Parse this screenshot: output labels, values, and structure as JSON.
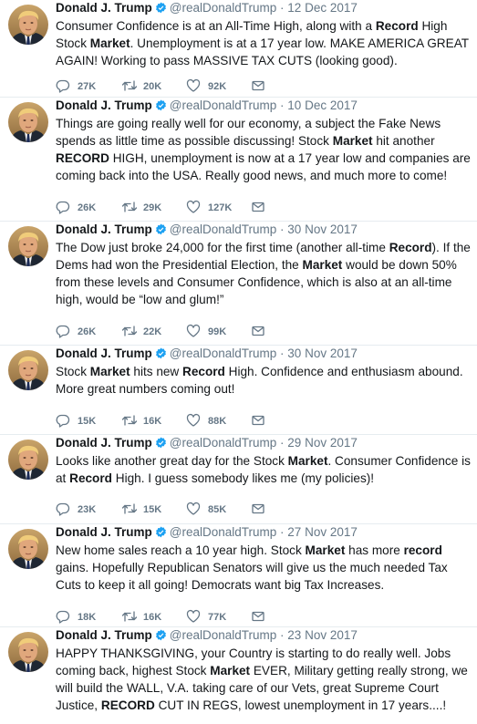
{
  "colors": {
    "text": "#14171a",
    "secondary": "#657786",
    "verified": "#1da1f2",
    "divider": "#e6ecf0"
  },
  "tweets": [
    {
      "name": "Donald J. Trump",
      "handle": "@realDonaldTrump",
      "separator": "·",
      "date": "12 Dec 2017",
      "text_segments": [
        {
          "t": "Consumer Confidence is at an All-Time High, along with a ",
          "b": false
        },
        {
          "t": "Record",
          "b": true
        },
        {
          "t": " High Stock ",
          "b": false
        },
        {
          "t": "Market",
          "b": true
        },
        {
          "t": ". Unemployment is at a 17 year low. MAKE AMERICA GREAT AGAIN! Working to pass MASSIVE TAX CUTS (looking good).",
          "b": false
        }
      ],
      "replies": "27K",
      "retweets": "20K",
      "likes": "92K"
    },
    {
      "name": "Donald J. Trump",
      "handle": "@realDonaldTrump",
      "separator": "·",
      "date": "10 Dec 2017",
      "text_segments": [
        {
          "t": "Things are going really well for our economy, a subject the Fake News spends as little time as possible discussing! Stock ",
          "b": false
        },
        {
          "t": "Market",
          "b": true
        },
        {
          "t": " hit another ",
          "b": false
        },
        {
          "t": "RECORD",
          "b": true
        },
        {
          "t": " HIGH, unemployment is now at a 17 year low and companies are coming back into the USA. Really good news, and much more to come!",
          "b": false
        }
      ],
      "replies": "26K",
      "retweets": "29K",
      "likes": "127K"
    },
    {
      "name": "Donald J. Trump",
      "handle": "@realDonaldTrump",
      "separator": "·",
      "date": "30 Nov 2017",
      "text_segments": [
        {
          "t": "The Dow just broke 24,000 for the first time (another all-time ",
          "b": false
        },
        {
          "t": "Record",
          "b": true
        },
        {
          "t": "). If the Dems had won the Presidential Election, the ",
          "b": false
        },
        {
          "t": "Market",
          "b": true
        },
        {
          "t": " would be down 50% from these levels and Consumer Confidence, which is also at an all-time high, would be “low and glum!”",
          "b": false
        }
      ],
      "replies": "26K",
      "retweets": "22K",
      "likes": "99K"
    },
    {
      "name": "Donald J. Trump",
      "handle": "@realDonaldTrump",
      "separator": "·",
      "date": "30 Nov 2017",
      "text_segments": [
        {
          "t": "Stock ",
          "b": false
        },
        {
          "t": "Market",
          "b": true
        },
        {
          "t": " hits new ",
          "b": false
        },
        {
          "t": "Record",
          "b": true
        },
        {
          "t": " High. Confidence and enthusiasm abound. More great numbers coming out!",
          "b": false
        }
      ],
      "replies": "15K",
      "retweets": "16K",
      "likes": "88K"
    },
    {
      "name": "Donald J. Trump",
      "handle": "@realDonaldTrump",
      "separator": "·",
      "date": "29 Nov 2017",
      "text_segments": [
        {
          "t": "Looks like another great day for the Stock ",
          "b": false
        },
        {
          "t": "Market",
          "b": true
        },
        {
          "t": ". Consumer Confidence is at ",
          "b": false
        },
        {
          "t": "Record",
          "b": true
        },
        {
          "t": " High. I guess somebody likes me (my policies)!",
          "b": false
        }
      ],
      "replies": "23K",
      "retweets": "15K",
      "likes": "85K"
    },
    {
      "name": "Donald J. Trump",
      "handle": "@realDonaldTrump",
      "separator": "·",
      "date": "27 Nov 2017",
      "text_segments": [
        {
          "t": "New home sales reach a 10 year high. Stock ",
          "b": false
        },
        {
          "t": "Market",
          "b": true
        },
        {
          "t": " has more ",
          "b": false
        },
        {
          "t": "record",
          "b": true
        },
        {
          "t": " gains. Hopefully Republican Senators will give us the much needed Tax Cuts to keep it all going! Democrats want big Tax Increases.",
          "b": false
        }
      ],
      "replies": "18K",
      "retweets": "16K",
      "likes": "77K"
    },
    {
      "name": "Donald J. Trump",
      "handle": "@realDonaldTrump",
      "separator": "·",
      "date": "23 Nov 2017",
      "text_segments": [
        {
          "t": "HAPPY THANKSGIVING, your Country is starting to do really well. Jobs coming back, highest Stock ",
          "b": false
        },
        {
          "t": "Market",
          "b": true
        },
        {
          "t": " EVER, Military getting really strong, we will build the WALL, V.A. taking care of our Vets, great Supreme Court Justice, ",
          "b": false
        },
        {
          "t": "RECORD",
          "b": true
        },
        {
          "t": " CUT IN REGS, lowest unemployment in 17 years....!",
          "b": false
        }
      ],
      "replies": null,
      "retweets": null,
      "likes": null
    }
  ]
}
